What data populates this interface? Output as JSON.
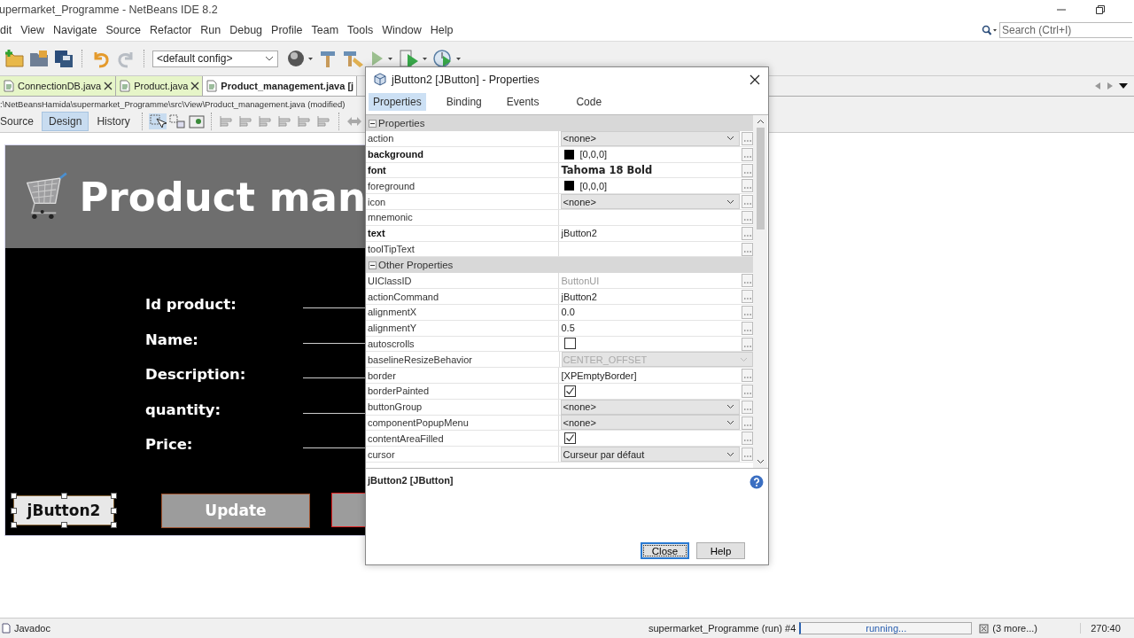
{
  "window": {
    "title": "upermarket_Programme - NetBeans IDE 8.2"
  },
  "menu": [
    "dit",
    "View",
    "Navigate",
    "Source",
    "Refactor",
    "Run",
    "Debug",
    "Profile",
    "Team",
    "Tools",
    "Window",
    "Help"
  ],
  "search": {
    "placeholder": "Search (Ctrl+I)"
  },
  "toolbar": {
    "config": "<default config>"
  },
  "editor_tabs": [
    {
      "label": "ConnectionDB.java",
      "selected": false,
      "closable": true
    },
    {
      "label": "Product.java",
      "selected": false,
      "closable": true
    },
    {
      "label": "Product_management.java [j",
      "selected": true,
      "closable": false
    }
  ],
  "file_path": ":\\NetBeansHamida\\supermarket_Programme\\src\\View\\Product_management.java (modified)",
  "view_tabs": [
    {
      "label": "Source",
      "selected": false
    },
    {
      "label": "Design",
      "selected": true
    },
    {
      "label": "History",
      "selected": false
    }
  ],
  "form": {
    "title": "Product man",
    "fields": [
      "Id product:",
      "Name:",
      "Description:",
      "quantity:",
      "Price:"
    ],
    "buttons": [
      {
        "label": "jButton2",
        "selected": true,
        "color": "#8b6a3e"
      },
      {
        "label": "Update",
        "selected": false,
        "color": "#a0522d"
      },
      {
        "selected": false,
        "color": "#e02020"
      }
    ]
  },
  "dialog": {
    "title": "jButton2 [JButton] - Properties",
    "tabs": [
      {
        "label": "Properties",
        "selected": true
      },
      {
        "label": "Binding",
        "selected": false
      },
      {
        "label": "Events",
        "selected": false
      },
      {
        "label": "Code",
        "selected": false
      }
    ],
    "groups": [
      {
        "name": "Properties",
        "expanded": true,
        "rows": [
          {
            "name": "action",
            "bold": false,
            "kind": "combo",
            "value": "<none>"
          },
          {
            "name": "background",
            "bold": true,
            "kind": "color",
            "value": "[0,0,0]",
            "color": "#000000"
          },
          {
            "name": "font",
            "bold": true,
            "kind": "font",
            "value": "Tahoma 18 Bold"
          },
          {
            "name": "foreground",
            "bold": false,
            "kind": "color",
            "value": "[0,0,0]",
            "color": "#000000"
          },
          {
            "name": "icon",
            "bold": false,
            "kind": "combo",
            "value": "<none>"
          },
          {
            "name": "mnemonic",
            "bold": false,
            "kind": "text"
          },
          {
            "name": "text",
            "bold": true,
            "kind": "text",
            "value": "jButton2"
          },
          {
            "name": "toolTipText",
            "bold": false,
            "kind": "text"
          }
        ]
      },
      {
        "name": "Other Properties",
        "expanded": true,
        "rows": [
          {
            "name": "UIClassID",
            "bold": false,
            "kind": "readonly",
            "value": "ButtonUI"
          },
          {
            "name": "actionCommand",
            "bold": false,
            "kind": "text",
            "value": "jButton2"
          },
          {
            "name": "alignmentX",
            "bold": false,
            "kind": "text",
            "value": "0.0"
          },
          {
            "name": "alignmentY",
            "bold": false,
            "kind": "text",
            "value": "0.5"
          },
          {
            "name": "autoscrolls",
            "bold": false,
            "kind": "checkbox",
            "checked": false
          },
          {
            "name": "baselineResizeBehavior",
            "bold": false,
            "kind": "disabled_combo",
            "value": "CENTER_OFFSET"
          },
          {
            "name": "border",
            "bold": false,
            "kind": "text",
            "value": "[XPEmptyBorder]"
          },
          {
            "name": "borderPainted",
            "bold": false,
            "kind": "checkbox",
            "checked": true
          },
          {
            "name": "buttonGroup",
            "bold": false,
            "kind": "combo",
            "value": "<none>"
          },
          {
            "name": "componentPopupMenu",
            "bold": false,
            "kind": "combo",
            "value": "<none>"
          },
          {
            "name": "contentAreaFilled",
            "bold": false,
            "kind": "checkbox",
            "checked": true
          },
          {
            "name": "cursor",
            "bold": false,
            "kind": "combo",
            "value": "Curseur par défaut"
          }
        ]
      }
    ],
    "description": "jButton2 [JButton]",
    "buttons": [
      {
        "label": "Close",
        "selected": true
      },
      {
        "label": "Help",
        "selected": false
      }
    ]
  },
  "status_bar": {
    "left": "Javadoc",
    "run": "supermarket_Programme (run) #4",
    "progress": "running...",
    "more": "(3 more...)",
    "position": "270:40"
  }
}
